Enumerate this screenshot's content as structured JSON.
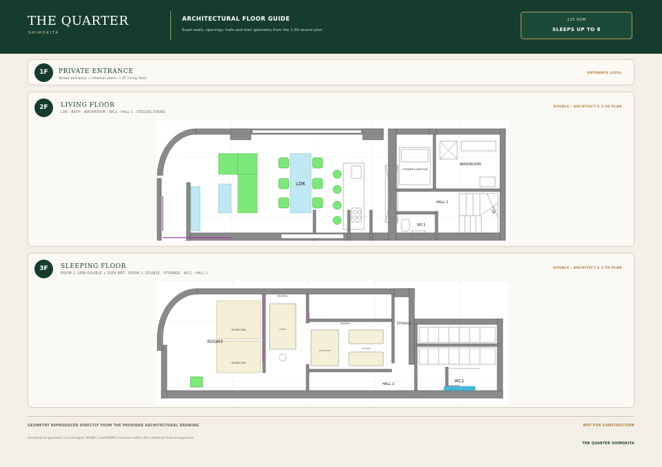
{
  "header": {
    "brand": "THE QUARTER",
    "brand_sub": "SHIMOKITA",
    "guide_title": "ARCHITECTURAL FLOOR GUIDE",
    "guide_desc": "Exact walls, openings, halls and stair geometry from the 1:50 source plan",
    "area": "115 SQM",
    "sleeps": "SLEEPS UP TO 8"
  },
  "floors": [
    {
      "badge": "1F",
      "title": "PRIVATE ENTRANCE",
      "subtitle": "Street entrance → internal stairs → 2F living floor",
      "tag": "ENTRANCE LEVEL"
    },
    {
      "badge": "2F",
      "title": "LIVING FLOOR",
      "subtitle": "LDK · BATH · WASHROOM · WC1 · HALL 1 · DOGLEG STAIRS",
      "tag": "DOUBLE · ARCHITECT'S 1:50 PLAN",
      "labels": {
        "ldk": "LDK",
        "shower": "SHOWER & BATHTUB",
        "washroom": "WASHROOM",
        "hall": "HALL 1",
        "wc": "WC1"
      }
    },
    {
      "badge": "3F",
      "title": "SLEEPING FLOOR",
      "subtitle": "ROOM 1: SEMI-DOUBLE + SOFA BED · ROOM 2: DOUBLE · STORAGE · WC2 · HALL 2",
      "tag": "DOUBLE · ARCHITECT'S 1:50 PLAN",
      "labels": {
        "room3": "ROOM3",
        "double_bed_a": "DOUBLE BED",
        "double_bed_b": "DOUBLE BED",
        "room2": "ROOM 2",
        "double_small": "DOUBLE",
        "room1": "ROOM 1",
        "semi_double": "SEMI-DOUBLE",
        "sofa_bed": "SOFA BED",
        "storage": "STORAGE",
        "hall": "HALL 2",
        "wc": "WC2",
        "hand_basin": "HAND BASIN"
      }
    }
  ],
  "footer": {
    "note": "GEOMETRY REPRODUCED DIRECTLY FROM THE PROVIDED ARCHITECTURAL DRAWING",
    "not_for_construction": "NOT FOR CONSTRUCTION",
    "small": "Architectural geometry is unchanged. ROOM 1 and ROOM 2 furniture reflect the confirmed final arrangement.",
    "brand": "THE QUARTER SHIMOKITA"
  },
  "colors": {
    "brand_green": "#153c2e",
    "accent_gold": "#b89a5a",
    "tag_orange": "#b07a3a",
    "furniture_green": "#7de87a",
    "fixture_blue": "#bfe9f2",
    "bed_cream": "#f4f0d8"
  }
}
